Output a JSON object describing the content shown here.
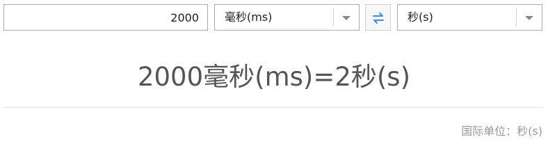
{
  "input": {
    "value": "2000"
  },
  "from_unit": {
    "selected": "毫秒(ms)"
  },
  "to_unit": {
    "selected": "秒(s)"
  },
  "swap": {
    "icon": "swap-arrows-icon",
    "color": "#3b8be8"
  },
  "result": {
    "text": "2000毫秒(ms)=2秒(s)"
  },
  "si_unit": {
    "text": "国际单位：秒(s)"
  }
}
